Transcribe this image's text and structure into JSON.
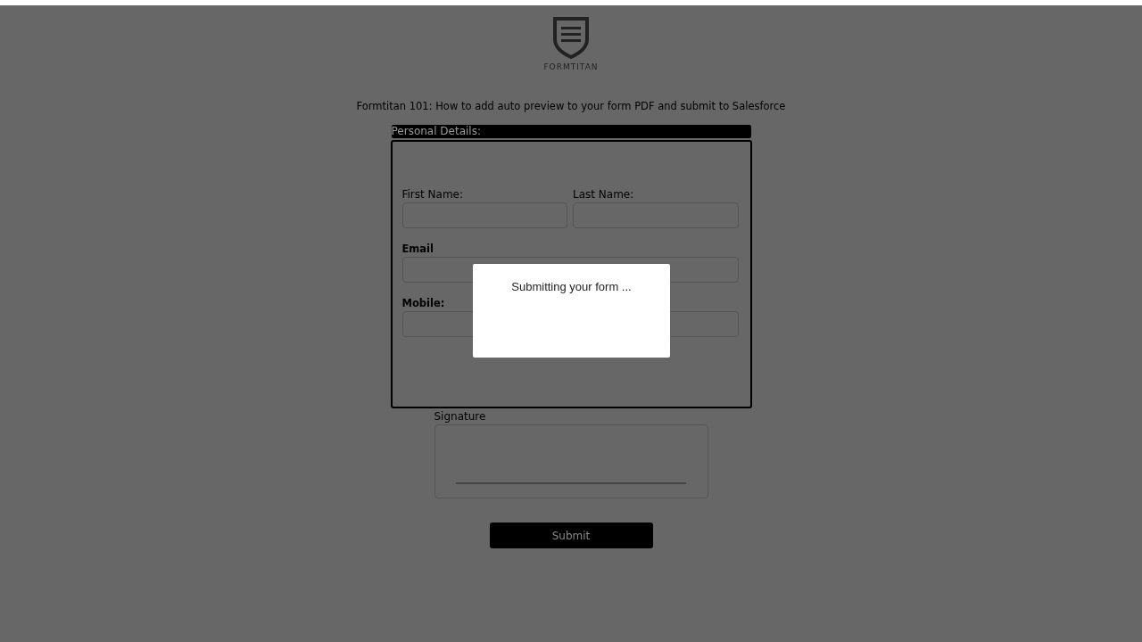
{
  "logo": {
    "text": "FORMTITAN"
  },
  "title": "Formtitan 101: How to add auto preview to your form PDF and submit to Salesforce",
  "section": {
    "title": "Personal Details:",
    "rows": [
      [
        {
          "label": "First Name:",
          "bold": false
        },
        {
          "label": "Last Name:",
          "bold": false
        }
      ],
      [
        {
          "label": "Email",
          "bold": true
        }
      ],
      [
        {
          "label": "Mobile:",
          "bold": true
        }
      ]
    ]
  },
  "signature": {
    "label": "Signature"
  },
  "submit": "Submit",
  "modal": {
    "message": "Submitting your form ..."
  }
}
